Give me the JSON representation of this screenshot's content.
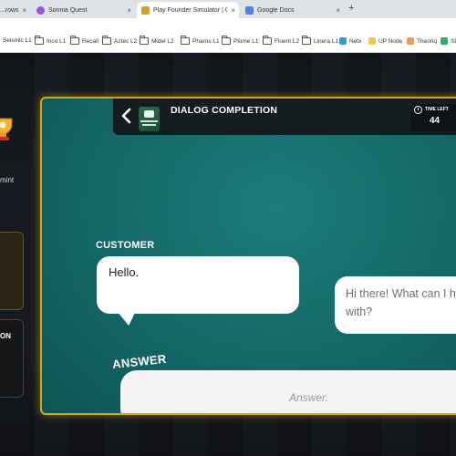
{
  "browser": {
    "tabs": [
      {
        "label": "...rowse.c",
        "active": false,
        "color": "#f2994a"
      },
      {
        "label": "Sonnia Quest",
        "active": false,
        "color": "#9b51e0"
      },
      {
        "label": "Play Founder Simulator | C",
        "active": true,
        "color": "#d4a51a"
      },
      {
        "label": "Google Docs",
        "active": false,
        "color": "#4285f4"
      }
    ],
    "new_tab_label": "+",
    "bookmarks": [
      {
        "label": "Seismic L1",
        "kind": "folder"
      },
      {
        "label": "Inco L1",
        "kind": "folder"
      },
      {
        "label": "Recall",
        "kind": "folder"
      },
      {
        "label": "Aztec L2",
        "kind": "folder"
      },
      {
        "label": "Midel L2",
        "kind": "folder"
      },
      {
        "label": "Pharos L1",
        "kind": "folder"
      },
      {
        "label": "Plume L1",
        "kind": "folder"
      },
      {
        "label": "Fluent L2",
        "kind": "folder"
      },
      {
        "label": "Linera L1",
        "kind": "folder"
      },
      {
        "label": "Netx",
        "kind": "site",
        "color": "#2d9cdb"
      },
      {
        "label": "UP Node",
        "kind": "site",
        "color": "#f2c94c"
      },
      {
        "label": "Theoriq",
        "kind": "site",
        "color": "#f2994a"
      },
      {
        "label": "St",
        "kind": "site",
        "color": "#27ae60"
      }
    ]
  },
  "sidebar": {
    "text_fragment": "mint",
    "label_fragment": "ON"
  },
  "dialog": {
    "title": "DIALOG COMPLETION",
    "timer_label": "TIME LEFT",
    "timer_value": "44",
    "customer_label": "CUSTOMER",
    "customer_message": "Hello.",
    "reply_message": "Hi there! What can I help you with?",
    "answer_label": "ANSWER",
    "answer_placeholder": "Answer."
  },
  "colors": {
    "card_border": "#d4a51a",
    "card_bg": "#136766",
    "header_bg": "#141c1f"
  }
}
